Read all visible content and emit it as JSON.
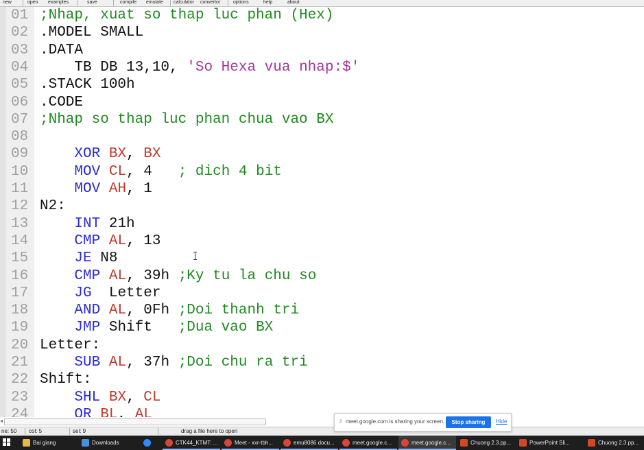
{
  "menu": {
    "items": [
      "new",
      "open",
      "examples",
      "save",
      "compile",
      "emulate",
      "calculator",
      "convertor",
      "options",
      "help",
      "about"
    ]
  },
  "editor": {
    "lines": [
      {
        "n": "01",
        "tokens": [
          {
            "t": ";Nhap, xuat so thap luc phan (Hex)",
            "c": "c"
          }
        ]
      },
      {
        "n": "02",
        "tokens": [
          {
            "t": ".MODEL SMALL",
            "c": ""
          }
        ]
      },
      {
        "n": "03",
        "tokens": [
          {
            "t": ".DATA",
            "c": ""
          }
        ]
      },
      {
        "n": "04",
        "tokens": [
          {
            "t": "    TB DB 13,10, ",
            "c": ""
          },
          {
            "t": "'So Hexa vua nhap:$'",
            "c": "s"
          }
        ]
      },
      {
        "n": "05",
        "tokens": [
          {
            "t": ".STACK 100h",
            "c": ""
          }
        ]
      },
      {
        "n": "06",
        "tokens": [
          {
            "t": ".CODE",
            "c": ""
          }
        ]
      },
      {
        "n": "07",
        "tokens": [
          {
            "t": ";Nhap so thap luc phan chua vao BX",
            "c": "c"
          }
        ]
      },
      {
        "n": "08",
        "tokens": []
      },
      {
        "n": "09",
        "tokens": [
          {
            "t": "    ",
            "c": ""
          },
          {
            "t": "XOR",
            "c": "k"
          },
          {
            "t": " ",
            "c": ""
          },
          {
            "t": "BX",
            "c": "r"
          },
          {
            "t": ", ",
            "c": ""
          },
          {
            "t": "BX",
            "c": "r"
          }
        ]
      },
      {
        "n": "10",
        "tokens": [
          {
            "t": "    ",
            "c": ""
          },
          {
            "t": "MOV",
            "c": "k"
          },
          {
            "t": " ",
            "c": ""
          },
          {
            "t": "CL",
            "c": "r"
          },
          {
            "t": ", 4   ",
            "c": ""
          },
          {
            "t": "; dich 4 bit",
            "c": "c"
          }
        ]
      },
      {
        "n": "11",
        "tokens": [
          {
            "t": "    ",
            "c": ""
          },
          {
            "t": "MOV",
            "c": "k"
          },
          {
            "t": " ",
            "c": ""
          },
          {
            "t": "AH",
            "c": "r"
          },
          {
            "t": ", 1",
            "c": ""
          }
        ]
      },
      {
        "n": "12",
        "tokens": [
          {
            "t": "N2:",
            "c": ""
          }
        ]
      },
      {
        "n": "13",
        "tokens": [
          {
            "t": "    ",
            "c": ""
          },
          {
            "t": "INT",
            "c": "k"
          },
          {
            "t": " 21h",
            "c": ""
          }
        ]
      },
      {
        "n": "14",
        "tokens": [
          {
            "t": "    ",
            "c": ""
          },
          {
            "t": "CMP",
            "c": "k"
          },
          {
            "t": " ",
            "c": ""
          },
          {
            "t": "AL",
            "c": "r"
          },
          {
            "t": ", 13",
            "c": ""
          }
        ]
      },
      {
        "n": "15",
        "tokens": [
          {
            "t": "    ",
            "c": ""
          },
          {
            "t": "JE",
            "c": "k"
          },
          {
            "t": " N8",
            "c": ""
          }
        ]
      },
      {
        "n": "16",
        "tokens": [
          {
            "t": "    ",
            "c": ""
          },
          {
            "t": "CMP",
            "c": "k"
          },
          {
            "t": " ",
            "c": ""
          },
          {
            "t": "AL",
            "c": "r"
          },
          {
            "t": ", 39h ",
            "c": ""
          },
          {
            "t": ";Ky tu la chu so",
            "c": "c"
          }
        ]
      },
      {
        "n": "17",
        "tokens": [
          {
            "t": "    ",
            "c": ""
          },
          {
            "t": "JG",
            "c": "k"
          },
          {
            "t": "  Letter",
            "c": ""
          }
        ]
      },
      {
        "n": "18",
        "tokens": [
          {
            "t": "    ",
            "c": ""
          },
          {
            "t": "AND",
            "c": "k"
          },
          {
            "t": " ",
            "c": ""
          },
          {
            "t": "AL",
            "c": "r"
          },
          {
            "t": ", 0Fh ",
            "c": ""
          },
          {
            "t": ";Doi thanh tri",
            "c": "c"
          }
        ]
      },
      {
        "n": "19",
        "tokens": [
          {
            "t": "    ",
            "c": ""
          },
          {
            "t": "JMP",
            "c": "k"
          },
          {
            "t": " Shift   ",
            "c": ""
          },
          {
            "t": ";Dua vao BX",
            "c": "c"
          }
        ]
      },
      {
        "n": "20",
        "tokens": [
          {
            "t": "Letter:",
            "c": ""
          }
        ]
      },
      {
        "n": "21",
        "tokens": [
          {
            "t": "    ",
            "c": ""
          },
          {
            "t": "SUB",
            "c": "k"
          },
          {
            "t": " ",
            "c": ""
          },
          {
            "t": "AL",
            "c": "r"
          },
          {
            "t": ", 37h ",
            "c": ""
          },
          {
            "t": ";Doi chu ra tri",
            "c": "c"
          }
        ]
      },
      {
        "n": "22",
        "tokens": [
          {
            "t": "Shift:",
            "c": ""
          }
        ]
      },
      {
        "n": "23",
        "tokens": [
          {
            "t": "    ",
            "c": ""
          },
          {
            "t": "SHL",
            "c": "k"
          },
          {
            "t": " ",
            "c": ""
          },
          {
            "t": "BX",
            "c": "r"
          },
          {
            "t": ", ",
            "c": ""
          },
          {
            "t": "CL",
            "c": "r"
          }
        ]
      },
      {
        "n": "24",
        "tokens": [
          {
            "t": "    ",
            "c": ""
          },
          {
            "t": "OR",
            "c": "k"
          },
          {
            "t": " ",
            "c": ""
          },
          {
            "t": "BL",
            "c": "r"
          },
          {
            "t": ", ",
            "c": ""
          },
          {
            "t": "AL",
            "c": "r"
          }
        ]
      }
    ]
  },
  "status": {
    "line": "ne: 50",
    "col": "col: 5",
    "sel": "sel: 9",
    "hint": "drag a file here to open"
  },
  "share": {
    "text": "meet.google.com is sharing your screen.",
    "stop_label": "Stop sharing",
    "hide_label": "Hide"
  },
  "taskbar": {
    "items": [
      {
        "label": "Bai giang",
        "icon": "folder-icon",
        "color": "#e8b84a"
      },
      {
        "label": "Downloads",
        "icon": "download-icon",
        "color": "#4a90d9"
      },
      {
        "label": "",
        "icon": "zoom-icon",
        "color": "#2d8cff"
      },
      {
        "label": "CTK44_KTMT: ...",
        "icon": "chrome-icon",
        "color": "#db4437"
      },
      {
        "label": "Meet - xxr-tbh...",
        "icon": "chrome-icon",
        "color": "#db4437"
      },
      {
        "label": "emu8086 docu...",
        "icon": "chrome-icon",
        "color": "#db4437"
      },
      {
        "label": "meet.google.c...",
        "icon": "chrome-icon",
        "color": "#db4437"
      },
      {
        "label": "meet.google.c...",
        "icon": "chrome-icon",
        "color": "#db4437"
      },
      {
        "label": "Chuong 2.3.pp...",
        "icon": "powerpoint-icon",
        "color": "#d24726"
      },
      {
        "label": "PowerPoint Sli...",
        "icon": "powerpoint-icon",
        "color": "#d24726"
      },
      {
        "label": "Chuong 2.3.pp...",
        "icon": "powerpoint-icon",
        "color": "#d24726"
      }
    ]
  },
  "colors": {
    "keyword": "#2a2ad6",
    "register": "#c0392b",
    "comment": "#1f8a1f",
    "string": "#a4379b",
    "line_number": "#a0a0a0"
  }
}
